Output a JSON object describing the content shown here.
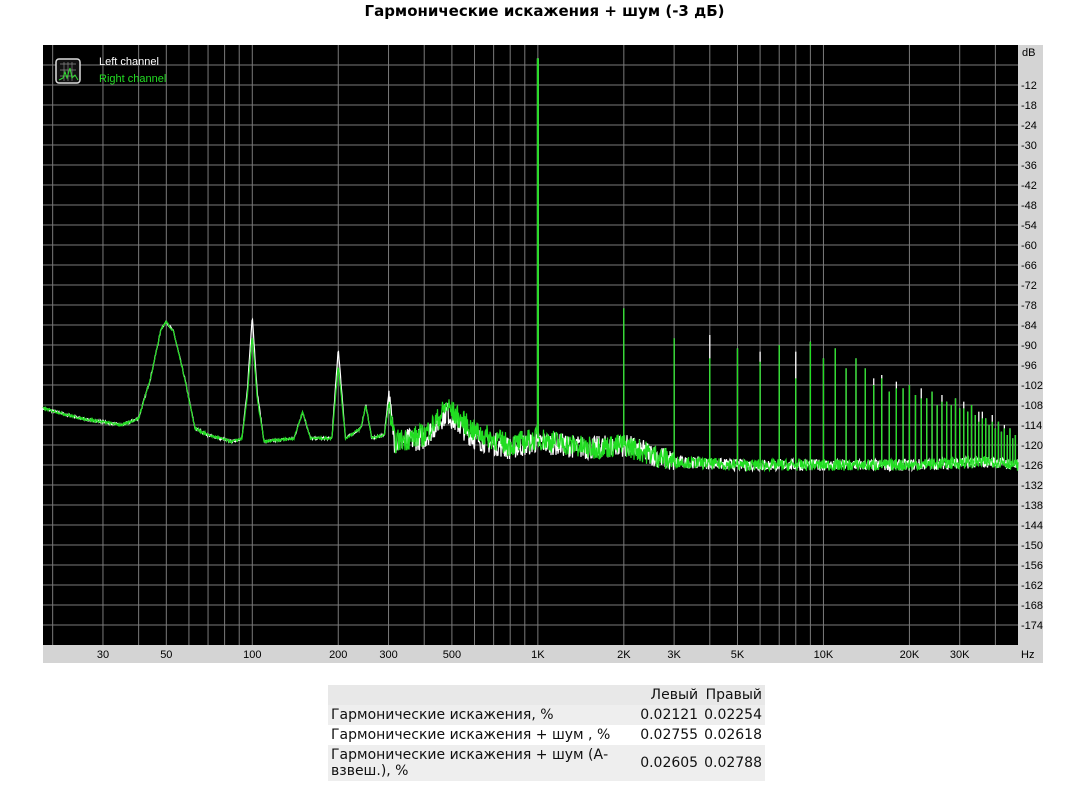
{
  "chart_data": {
    "type": "line",
    "title": "Гармонические искажения + шум (-3 дБ)",
    "xlabel": "Hz",
    "ylabel": "dB",
    "xscale": "log",
    "xlim": [
      18.5,
      48000
    ],
    "ylim": [
      -180,
      0
    ],
    "grid": true,
    "legend_position": "top-left",
    "x_ticks": [
      {
        "v": 30,
        "label": "30"
      },
      {
        "v": 50,
        "label": "50"
      },
      {
        "v": 100,
        "label": "100"
      },
      {
        "v": 200,
        "label": "200"
      },
      {
        "v": 300,
        "label": "300"
      },
      {
        "v": 500,
        "label": "500"
      },
      {
        "v": 1000,
        "label": "1K"
      },
      {
        "v": 2000,
        "label": "2K"
      },
      {
        "v": 3000,
        "label": "3K"
      },
      {
        "v": 5000,
        "label": "5K"
      },
      {
        "v": 10000,
        "label": "10K"
      },
      {
        "v": 20000,
        "label": "20K"
      },
      {
        "v": 30000,
        "label": "30K"
      }
    ],
    "y_ticks": [
      -12,
      -18,
      -24,
      -30,
      -36,
      -42,
      -48,
      -54,
      -60,
      -66,
      -72,
      -78,
      -84,
      -90,
      -96,
      -102,
      -108,
      -114,
      -120,
      -126,
      -132,
      -138,
      -144,
      -150,
      -156,
      -162,
      -168,
      -174
    ],
    "series": [
      {
        "name": "Left channel",
        "color": "#ffffff",
        "floor": [
          [
            18.5,
            -109
          ],
          [
            25,
            -112
          ],
          [
            35,
            -114
          ],
          [
            40,
            -112
          ],
          [
            44,
            -100
          ],
          [
            48,
            -85
          ],
          [
            50,
            -83
          ],
          [
            53,
            -86
          ],
          [
            58,
            -100
          ],
          [
            63,
            -115
          ],
          [
            70,
            -117
          ],
          [
            85,
            -119
          ],
          [
            92,
            -118
          ],
          [
            96,
            -104
          ],
          [
            100,
            -81
          ],
          [
            104,
            -104
          ],
          [
            110,
            -119
          ],
          [
            140,
            -118
          ],
          [
            150,
            -110
          ],
          [
            160,
            -118
          ],
          [
            190,
            -118
          ],
          [
            200,
            -91
          ],
          [
            212,
            -118
          ],
          [
            240,
            -115
          ],
          [
            250,
            -108
          ],
          [
            262,
            -118
          ],
          [
            290,
            -117
          ],
          [
            300,
            -105
          ],
          [
            315,
            -119
          ],
          [
            400,
            -118
          ],
          [
            450,
            -113
          ],
          [
            480,
            -110
          ],
          [
            500,
            -112
          ],
          [
            600,
            -118
          ],
          [
            800,
            -121
          ],
          [
            1000,
            -119
          ],
          [
            1500,
            -121
          ],
          [
            2000,
            -120
          ],
          [
            3000,
            -125
          ],
          [
            5000,
            -126
          ],
          [
            20000,
            -126
          ],
          [
            40000,
            -125
          ],
          [
            48000,
            -126
          ]
        ],
        "peaks": [
          [
            1000,
            -4
          ],
          [
            2000,
            -79
          ],
          [
            3000,
            -88
          ],
          [
            4000,
            -87
          ],
          [
            5000,
            -91
          ],
          [
            6000,
            -92
          ],
          [
            7000,
            -90
          ],
          [
            8000,
            -92
          ],
          [
            9000,
            -89
          ],
          [
            10000,
            -94
          ],
          [
            11000,
            -91
          ],
          [
            12000,
            -97
          ],
          [
            13000,
            -94
          ],
          [
            14000,
            -97
          ],
          [
            15000,
            -100
          ],
          [
            16000,
            -99
          ],
          [
            17000,
            -104
          ],
          [
            18000,
            -101
          ],
          [
            19000,
            -103
          ],
          [
            20000,
            -102
          ],
          [
            21000,
            -105
          ],
          [
            22000,
            -103
          ],
          [
            23000,
            -106
          ],
          [
            24000,
            -104
          ],
          [
            25000,
            -108
          ],
          [
            26000,
            -105
          ],
          [
            27000,
            -107
          ],
          [
            28000,
            -108
          ],
          [
            29000,
            -106
          ],
          [
            30000,
            -109
          ],
          [
            31000,
            -107
          ],
          [
            32000,
            -110
          ],
          [
            33000,
            -108
          ],
          [
            34000,
            -111
          ],
          [
            35000,
            -110
          ],
          [
            36000,
            -110
          ],
          [
            37000,
            -112
          ],
          [
            38000,
            -114
          ],
          [
            39000,
            -111
          ],
          [
            40000,
            -115
          ],
          [
            41000,
            -113
          ],
          [
            42000,
            -116
          ],
          [
            43000,
            -114
          ],
          [
            44000,
            -117
          ],
          [
            45000,
            -115
          ],
          [
            46000,
            -118
          ],
          [
            47000,
            -117
          ]
        ]
      },
      {
        "name": "Right channel",
        "color": "#22dd22",
        "floor": [
          [
            18.5,
            -109
          ],
          [
            25,
            -112
          ],
          [
            35,
            -114
          ],
          [
            40,
            -112
          ],
          [
            44,
            -100
          ],
          [
            48,
            -85
          ],
          [
            50,
            -83
          ],
          [
            53,
            -86
          ],
          [
            58,
            -100
          ],
          [
            63,
            -115
          ],
          [
            70,
            -117
          ],
          [
            85,
            -119
          ],
          [
            92,
            -118
          ],
          [
            96,
            -106
          ],
          [
            100,
            -87
          ],
          [
            104,
            -106
          ],
          [
            110,
            -119
          ],
          [
            140,
            -118
          ],
          [
            150,
            -110
          ],
          [
            160,
            -118
          ],
          [
            190,
            -118
          ],
          [
            200,
            -96
          ],
          [
            212,
            -118
          ],
          [
            240,
            -115
          ],
          [
            250,
            -108
          ],
          [
            262,
            -118
          ],
          [
            290,
            -117
          ],
          [
            300,
            -108
          ],
          [
            315,
            -119
          ],
          [
            400,
            -117
          ],
          [
            450,
            -112
          ],
          [
            480,
            -108
          ],
          [
            500,
            -110
          ],
          [
            600,
            -116
          ],
          [
            800,
            -120
          ],
          [
            1000,
            -118
          ],
          [
            1500,
            -121
          ],
          [
            2000,
            -120
          ],
          [
            3000,
            -125
          ],
          [
            5000,
            -126
          ],
          [
            20000,
            -126
          ],
          [
            40000,
            -125
          ],
          [
            48000,
            -126
          ]
        ],
        "peaks": [
          [
            1000,
            -4
          ],
          [
            2000,
            -79
          ],
          [
            3000,
            -88
          ],
          [
            4000,
            -94
          ],
          [
            5000,
            -91
          ],
          [
            6000,
            -95
          ],
          [
            7000,
            -90
          ],
          [
            8000,
            -100
          ],
          [
            9000,
            -89
          ],
          [
            10000,
            -94
          ],
          [
            11000,
            -91
          ],
          [
            12000,
            -97
          ],
          [
            13000,
            -94
          ],
          [
            14000,
            -97
          ],
          [
            15000,
            -102
          ],
          [
            16000,
            -100
          ],
          [
            17000,
            -104
          ],
          [
            18000,
            -103
          ],
          [
            19000,
            -103
          ],
          [
            20000,
            -102
          ],
          [
            21000,
            -105
          ],
          [
            22000,
            -106
          ],
          [
            23000,
            -106
          ],
          [
            24000,
            -104
          ],
          [
            25000,
            -108
          ],
          [
            26000,
            -107
          ],
          [
            27000,
            -107
          ],
          [
            28000,
            -108
          ],
          [
            29000,
            -106
          ],
          [
            30000,
            -109
          ],
          [
            31000,
            -109
          ],
          [
            32000,
            -110
          ],
          [
            33000,
            -108
          ],
          [
            34000,
            -111
          ],
          [
            35000,
            -113
          ],
          [
            36000,
            -112
          ],
          [
            37000,
            -112
          ],
          [
            38000,
            -114
          ],
          [
            39000,
            -113
          ],
          [
            40000,
            -115
          ],
          [
            41000,
            -113
          ],
          [
            42000,
            -116
          ],
          [
            43000,
            -115
          ],
          [
            44000,
            -117
          ],
          [
            45000,
            -115
          ],
          [
            46000,
            -118
          ],
          [
            47000,
            -117
          ]
        ]
      }
    ]
  },
  "table": {
    "headers": [
      "",
      "Левый",
      "Правый"
    ],
    "rows": [
      {
        "label": "Гармонические искажения, %",
        "left": "0.02121",
        "right": "0.02254"
      },
      {
        "label": "Гармонические искажения + шум , %",
        "left": "0.02755",
        "right": "0.02618"
      },
      {
        "label": "Гармонические искажения + шум (А-взвеш.), %",
        "left": "0.02605",
        "right": "0.02788"
      }
    ]
  }
}
